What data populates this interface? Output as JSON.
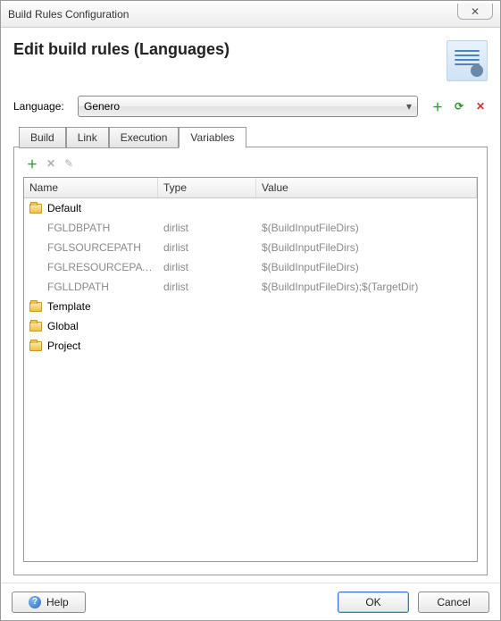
{
  "window": {
    "title": "Build Rules Configuration"
  },
  "heading": "Edit build rules (Languages)",
  "language": {
    "label": "Language:",
    "selected": "Genero"
  },
  "tabs": [
    {
      "id": "build",
      "label": "Build"
    },
    {
      "id": "link",
      "label": "Link"
    },
    {
      "id": "execution",
      "label": "Execution"
    },
    {
      "id": "variables",
      "label": "Variables",
      "active": true
    }
  ],
  "columns": {
    "name": "Name",
    "type": "Type",
    "value": "Value"
  },
  "tree": {
    "folders": [
      {
        "label": "Default",
        "vars": [
          {
            "name": "FGLDBPATH",
            "type": "dirlist",
            "value": "$(BuildInputFileDirs)"
          },
          {
            "name": "FGLSOURCEPATH",
            "type": "dirlist",
            "value": "$(BuildInputFileDirs)"
          },
          {
            "name": "FGLRESOURCEPATH",
            "type": "dirlist",
            "value": "$(BuildInputFileDirs)"
          },
          {
            "name": "FGLLDPATH",
            "type": "dirlist",
            "value": "$(BuildInputFileDirs);$(TargetDir)"
          }
        ]
      },
      {
        "label": "Template",
        "vars": []
      },
      {
        "label": "Global",
        "vars": []
      },
      {
        "label": "Project",
        "vars": []
      }
    ]
  },
  "buttons": {
    "help": "Help",
    "ok": "OK",
    "cancel": "Cancel"
  }
}
